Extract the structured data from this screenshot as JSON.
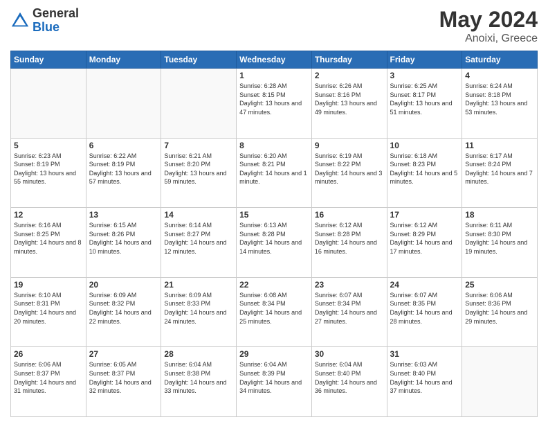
{
  "header": {
    "logo_general": "General",
    "logo_blue": "Blue",
    "title": "May 2024",
    "location": "Anoixi, Greece"
  },
  "days_of_week": [
    "Sunday",
    "Monday",
    "Tuesday",
    "Wednesday",
    "Thursday",
    "Friday",
    "Saturday"
  ],
  "weeks": [
    [
      {
        "day": "",
        "info": ""
      },
      {
        "day": "",
        "info": ""
      },
      {
        "day": "",
        "info": ""
      },
      {
        "day": "1",
        "info": "Sunrise: 6:28 AM\nSunset: 8:15 PM\nDaylight: 13 hours and 47 minutes."
      },
      {
        "day": "2",
        "info": "Sunrise: 6:26 AM\nSunset: 8:16 PM\nDaylight: 13 hours and 49 minutes."
      },
      {
        "day": "3",
        "info": "Sunrise: 6:25 AM\nSunset: 8:17 PM\nDaylight: 13 hours and 51 minutes."
      },
      {
        "day": "4",
        "info": "Sunrise: 6:24 AM\nSunset: 8:18 PM\nDaylight: 13 hours and 53 minutes."
      }
    ],
    [
      {
        "day": "5",
        "info": "Sunrise: 6:23 AM\nSunset: 8:19 PM\nDaylight: 13 hours and 55 minutes."
      },
      {
        "day": "6",
        "info": "Sunrise: 6:22 AM\nSunset: 8:19 PM\nDaylight: 13 hours and 57 minutes."
      },
      {
        "day": "7",
        "info": "Sunrise: 6:21 AM\nSunset: 8:20 PM\nDaylight: 13 hours and 59 minutes."
      },
      {
        "day": "8",
        "info": "Sunrise: 6:20 AM\nSunset: 8:21 PM\nDaylight: 14 hours and 1 minute."
      },
      {
        "day": "9",
        "info": "Sunrise: 6:19 AM\nSunset: 8:22 PM\nDaylight: 14 hours and 3 minutes."
      },
      {
        "day": "10",
        "info": "Sunrise: 6:18 AM\nSunset: 8:23 PM\nDaylight: 14 hours and 5 minutes."
      },
      {
        "day": "11",
        "info": "Sunrise: 6:17 AM\nSunset: 8:24 PM\nDaylight: 14 hours and 7 minutes."
      }
    ],
    [
      {
        "day": "12",
        "info": "Sunrise: 6:16 AM\nSunset: 8:25 PM\nDaylight: 14 hours and 8 minutes."
      },
      {
        "day": "13",
        "info": "Sunrise: 6:15 AM\nSunset: 8:26 PM\nDaylight: 14 hours and 10 minutes."
      },
      {
        "day": "14",
        "info": "Sunrise: 6:14 AM\nSunset: 8:27 PM\nDaylight: 14 hours and 12 minutes."
      },
      {
        "day": "15",
        "info": "Sunrise: 6:13 AM\nSunset: 8:28 PM\nDaylight: 14 hours and 14 minutes."
      },
      {
        "day": "16",
        "info": "Sunrise: 6:12 AM\nSunset: 8:28 PM\nDaylight: 14 hours and 16 minutes."
      },
      {
        "day": "17",
        "info": "Sunrise: 6:12 AM\nSunset: 8:29 PM\nDaylight: 14 hours and 17 minutes."
      },
      {
        "day": "18",
        "info": "Sunrise: 6:11 AM\nSunset: 8:30 PM\nDaylight: 14 hours and 19 minutes."
      }
    ],
    [
      {
        "day": "19",
        "info": "Sunrise: 6:10 AM\nSunset: 8:31 PM\nDaylight: 14 hours and 20 minutes."
      },
      {
        "day": "20",
        "info": "Sunrise: 6:09 AM\nSunset: 8:32 PM\nDaylight: 14 hours and 22 minutes."
      },
      {
        "day": "21",
        "info": "Sunrise: 6:09 AM\nSunset: 8:33 PM\nDaylight: 14 hours and 24 minutes."
      },
      {
        "day": "22",
        "info": "Sunrise: 6:08 AM\nSunset: 8:34 PM\nDaylight: 14 hours and 25 minutes."
      },
      {
        "day": "23",
        "info": "Sunrise: 6:07 AM\nSunset: 8:34 PM\nDaylight: 14 hours and 27 minutes."
      },
      {
        "day": "24",
        "info": "Sunrise: 6:07 AM\nSunset: 8:35 PM\nDaylight: 14 hours and 28 minutes."
      },
      {
        "day": "25",
        "info": "Sunrise: 6:06 AM\nSunset: 8:36 PM\nDaylight: 14 hours and 29 minutes."
      }
    ],
    [
      {
        "day": "26",
        "info": "Sunrise: 6:06 AM\nSunset: 8:37 PM\nDaylight: 14 hours and 31 minutes."
      },
      {
        "day": "27",
        "info": "Sunrise: 6:05 AM\nSunset: 8:37 PM\nDaylight: 14 hours and 32 minutes."
      },
      {
        "day": "28",
        "info": "Sunrise: 6:04 AM\nSunset: 8:38 PM\nDaylight: 14 hours and 33 minutes."
      },
      {
        "day": "29",
        "info": "Sunrise: 6:04 AM\nSunset: 8:39 PM\nDaylight: 14 hours and 34 minutes."
      },
      {
        "day": "30",
        "info": "Sunrise: 6:04 AM\nSunset: 8:40 PM\nDaylight: 14 hours and 36 minutes."
      },
      {
        "day": "31",
        "info": "Sunrise: 6:03 AM\nSunset: 8:40 PM\nDaylight: 14 hours and 37 minutes."
      },
      {
        "day": "",
        "info": ""
      }
    ]
  ]
}
